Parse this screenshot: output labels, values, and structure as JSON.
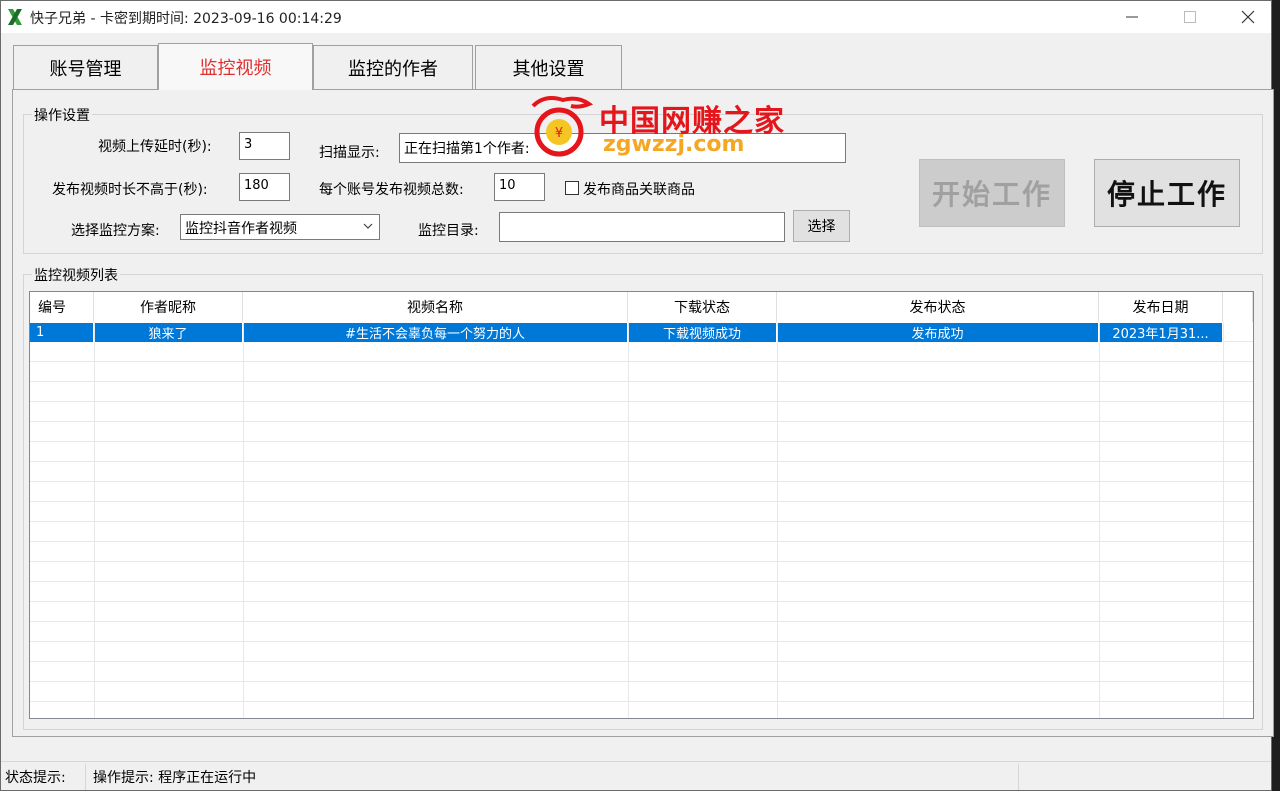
{
  "window": {
    "title": "快子兄弟  -   卡密到期时间: 2023-09-16 00:14:29"
  },
  "tabs": [
    {
      "label": "账号管理"
    },
    {
      "label": "监控视频"
    },
    {
      "label": "监控的作者"
    },
    {
      "label": "其他设置"
    }
  ],
  "settings": {
    "group_title": "操作设置",
    "upload_delay_label": "视频上传延时(秒):",
    "upload_delay_value": "3",
    "scan_display_label": "扫描显示:",
    "scan_display_value": "正在扫描第1个作者:",
    "max_duration_label": "发布视频时长不高于(秒):",
    "max_duration_value": "180",
    "total_per_account_label": "每个账号发布视频总数:",
    "total_per_account_value": "10",
    "publish_product_label": "发布商品关联商品",
    "scheme_label": "选择监控方案:",
    "scheme_value": "监控抖音作者视频",
    "directory_label": "监控目录:",
    "directory_value": "",
    "choose_button": "选择",
    "start_button": "开始工作",
    "stop_button": "停止工作"
  },
  "list": {
    "group_title": "监控视频列表",
    "columns": [
      "编号",
      "作者昵称",
      "视频名称",
      "下载状态",
      "发布状态",
      "发布日期"
    ],
    "rows": [
      [
        "1",
        "狼来了",
        "#生活不会辜负每一个努力的人",
        "下载视频成功",
        "发布成功",
        "2023年1月31..."
      ]
    ]
  },
  "watermark": {
    "line1": "中国网赚之家",
    "line2": "zgwzzj.com"
  },
  "status": {
    "label": "状态提示:",
    "message": "操作提示: 程序正在运行中"
  }
}
